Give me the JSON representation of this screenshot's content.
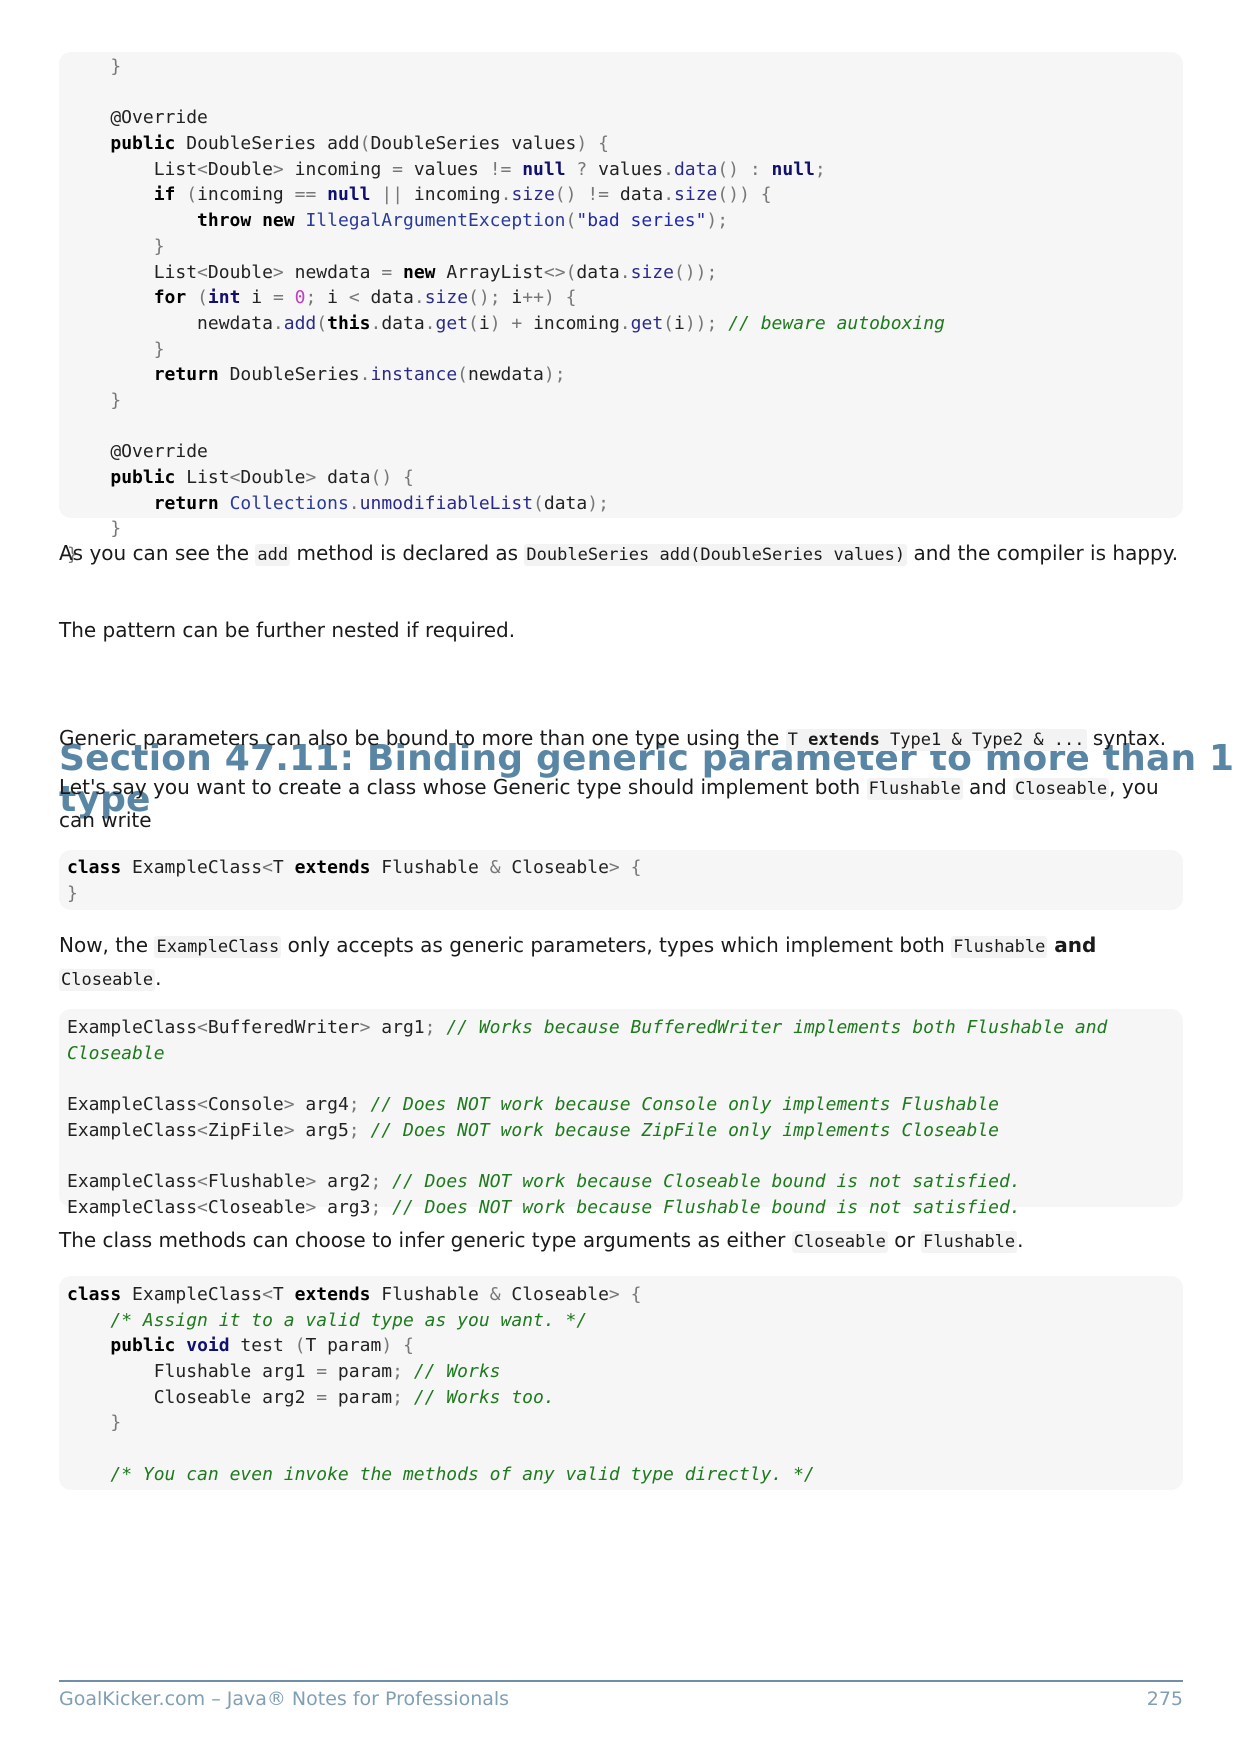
{
  "code_block_1": [
    "    }",
    "",
    "    @Override",
    "    public DoubleSeries add(DoubleSeries values) {",
    "        List<Double> incoming = values != null ? values.data() : null;",
    "        if (incoming == null || incoming.size() != data.size()) {",
    "            throw new IllegalArgumentException(\"bad series\");",
    "        }",
    "        List<Double> newdata = new ArrayList<>(data.size());",
    "        for (int i = 0; i < data.size(); i++) {",
    "            newdata.add(this.data.get(i) + incoming.get(i)); // beware autoboxing",
    "        }",
    "        return DoubleSeries.instance(newdata);",
    "    }",
    "",
    "    @Override",
    "    public List<Double> data() {",
    "        return Collections.unmodifiableList(data);",
    "    }",
    "}"
  ],
  "para_add_method": {
    "t1": "As you can see the ",
    "c1": "add",
    "t2": " method is declared as ",
    "c2": "DoubleSeries add(DoubleSeries values)",
    "t3": " and the compiler is happy."
  },
  "para_nested": "The pattern can be further nested if required.",
  "section_title": "Section 47.11: Binding generic parameter to more than 1 type",
  "para_bound": {
    "t1": "Generic parameters can also be bound to more than one type using the ",
    "c1_a": "T ",
    "c1_kw": "extends",
    "c1_b": " Type1 & Type2 & ...",
    "t2": " syntax."
  },
  "para_create": {
    "t1": "Let's say you want to create a class whose Generic type should implement both ",
    "c1": "Flushable",
    "t2": " and ",
    "c2": "Closeable",
    "t3": ", you can write"
  },
  "code_block_2": [
    "class ExampleClass<T extends Flushable & Closeable> {",
    "}"
  ],
  "para_now": {
    "t1": "Now, the ",
    "c1": "ExampleClass",
    "t2": " only accepts as generic parameters, types which implement both ",
    "c2": "Flushable",
    "t3": " and",
    "t4": " ",
    "c3": "Closeable",
    "t5": "."
  },
  "code_block_3": [
    "ExampleClass<BufferedWriter> arg1; // Works because BufferedWriter implements both Flushable and",
    "Closeable",
    "",
    "ExampleClass<Console> arg4; // Does NOT work because Console only implements Flushable",
    "ExampleClass<ZipFile> arg5; // Does NOT work because ZipFile only implements Closeable",
    "",
    "ExampleClass<Flushable> arg2; // Does NOT work because Closeable bound is not satisfied.",
    "ExampleClass<Closeable> arg3; // Does NOT work because Flushable bound is not satisfied."
  ],
  "para_infer": {
    "t1": "The class methods can choose to infer generic type arguments as either ",
    "c1": "Closeable",
    "t2": " or ",
    "c2": "Flushable",
    "t3": "."
  },
  "code_block_4": [
    "class ExampleClass<T extends Flushable & Closeable> {",
    "    /* Assign it to a valid type as you want. */",
    "    public void test (T param) {",
    "        Flushable arg1 = param; // Works",
    "        Closeable arg2 = param; // Works too.",
    "    }",
    "",
    "    /* You can even invoke the methods of any valid type directly. */"
  ],
  "footer": {
    "left": "GoalKicker.com – Java® Notes for Professionals",
    "page": "275"
  }
}
